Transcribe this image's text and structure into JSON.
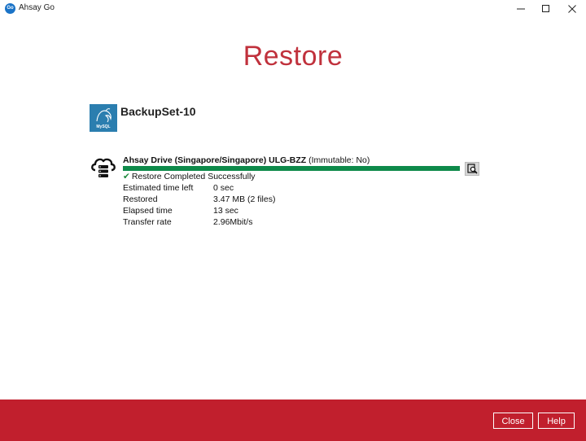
{
  "window": {
    "app_logo_text": "Go",
    "title": "Ahsay Go"
  },
  "page": {
    "title": "Restore"
  },
  "backupset": {
    "name": "BackupSet-10",
    "icon": "mysql-icon",
    "icon_label": "MySQL"
  },
  "destination": {
    "icon": "cloud-storage-icon",
    "name": "Ahsay Drive (Singapore/Singapore) ULG-BZZ",
    "suffix": "(Immutable: No)",
    "progress": 1.0,
    "status": "Restore Completed Successfully",
    "details": [
      {
        "label": "Estimated time left",
        "value": "0 sec"
      },
      {
        "label": "Restored",
        "value": "3.47 MB (2 files)"
      },
      {
        "label": "Elapsed time",
        "value": "13 sec"
      },
      {
        "label": "Transfer rate",
        "value": "2.96Mbit/s"
      }
    ]
  },
  "footer": {
    "close_label": "Close",
    "help_label": "Help"
  },
  "colors": {
    "accent": "#c0313c",
    "footer": "#c11f2d",
    "progress": "#0e8a4a",
    "mysql_icon_bg": "#2b7eaf"
  }
}
